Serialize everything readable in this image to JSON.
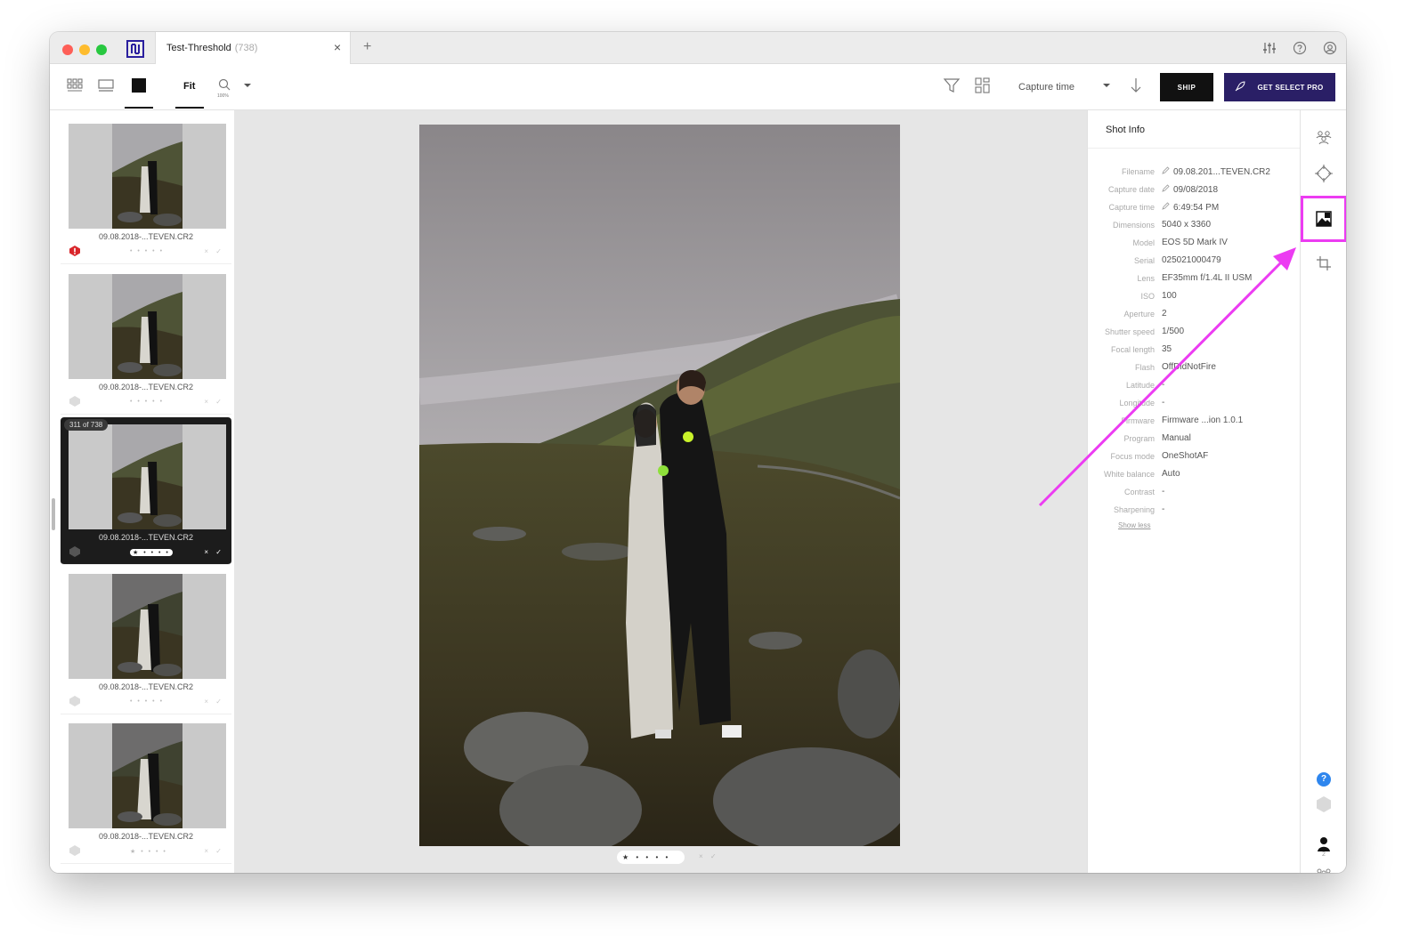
{
  "tab": {
    "title": "Test-Threshold",
    "count": "(738)",
    "close": "×",
    "new": "+"
  },
  "toolbar": {
    "fit_label": "Fit",
    "zoom_text": "100%",
    "sort_label": "Capture time",
    "ship_label": "SHIP",
    "pro_label": "GET SELECT PRO"
  },
  "filmstrip": {
    "counter": "311 of 738",
    "items": [
      {
        "name": "09.08.2018-...TEVEN.CR2",
        "dots": "• • • • •",
        "checks": "× ✓"
      },
      {
        "name": "09.08.2018-...TEVEN.CR2",
        "dots": "• • • • •",
        "checks": "× ✓"
      },
      {
        "name": "09.08.2018-...TEVEN.CR2",
        "dots": "★ • • • •",
        "checks": "× ✓"
      },
      {
        "name": "09.08.2018-...TEVEN.CR2",
        "dots": "• • • • •",
        "checks": "× ✓"
      },
      {
        "name": "09.08.2018-...TEVEN.CR2",
        "dots": "★ • • • •",
        "checks": "× ✓"
      }
    ]
  },
  "viewer": {
    "rating": "★ • • • •",
    "checks": "× ✓"
  },
  "shot_info": {
    "title": "Shot Info",
    "rows": [
      {
        "label": "Filename",
        "value": "09.08.201...TEVEN.CR2",
        "editable": true
      },
      {
        "label": "Capture date",
        "value": "09/08/2018",
        "editable": true
      },
      {
        "label": "Capture time",
        "value": "6:49:54 PM",
        "editable": true
      },
      {
        "label": "Dimensions",
        "value": "5040 x 3360"
      },
      {
        "label": "Model",
        "value": "EOS 5D Mark IV"
      },
      {
        "label": "Serial",
        "value": "025021000479"
      },
      {
        "label": "Lens",
        "value": "EF35mm f/1.4L II USM"
      },
      {
        "label": "ISO",
        "value": "100"
      },
      {
        "label": "Aperture",
        "value": "2"
      },
      {
        "label": "Shutter speed",
        "value": "1/500"
      },
      {
        "label": "Focal length",
        "value": "35"
      },
      {
        "label": "Flash",
        "value": "OffDidNotFire"
      },
      {
        "label": "Latitude",
        "value": "-"
      },
      {
        "label": "Longitude",
        "value": "-"
      },
      {
        "label": "Firmware",
        "value": "Firmware ...ion 1.0.1"
      },
      {
        "label": "Program",
        "value": "Manual"
      },
      {
        "label": "Focus mode",
        "value": "OneShotAF"
      },
      {
        "label": "White balance",
        "value": "Auto"
      },
      {
        "label": "Contrast",
        "value": "-"
      },
      {
        "label": "Sharpening",
        "value": "-"
      }
    ],
    "show_less": "Show less"
  },
  "rail": {
    "faces_count": "2",
    "people_count": "0",
    "help": "?"
  },
  "colors": {
    "accent_pro": "#2a1f66",
    "highlight": "#ec3cf2",
    "ship": "#111111"
  }
}
